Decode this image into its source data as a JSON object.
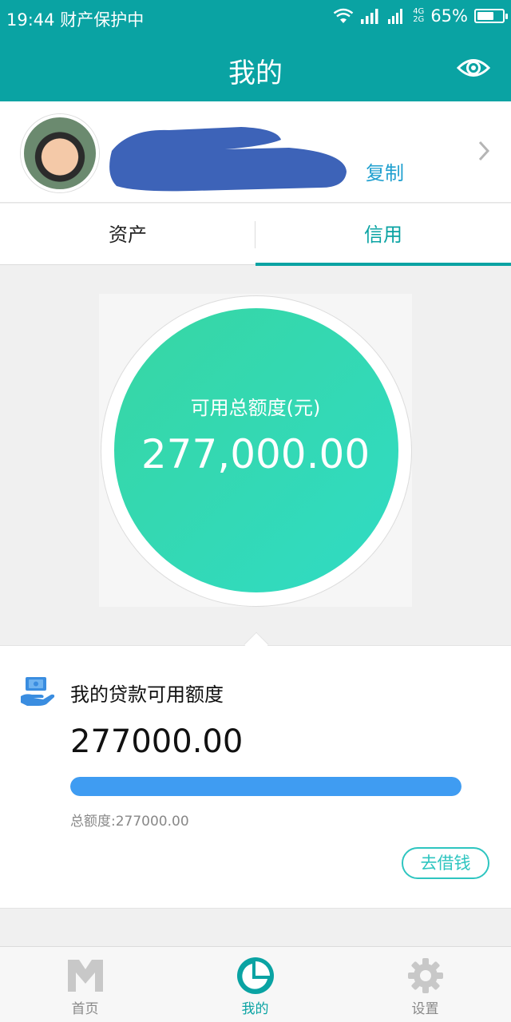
{
  "status_bar": {
    "time": "19:44",
    "notification": "财产保护中",
    "network": [
      "4G",
      "2G"
    ],
    "battery": "65%",
    "battery_level": 0.65
  },
  "header": {
    "title": "我的"
  },
  "profile": {
    "copy_label": "复制"
  },
  "tabs": [
    {
      "label": "资产"
    },
    {
      "label": "信用"
    }
  ],
  "credit": {
    "available_label": "可用总额度(元)",
    "available_value": "277,000.00"
  },
  "loan": {
    "title": "我的贷款可用额度",
    "amount": "277000.00",
    "progress": 1.0,
    "total_label": "总额度:277000.00",
    "borrow_button": "去借钱"
  },
  "bottom_nav": [
    {
      "label": "首页",
      "icon": "home-m-icon"
    },
    {
      "label": "我的",
      "icon": "pie-chart-icon"
    },
    {
      "label": "设置",
      "icon": "gear-icon"
    }
  ],
  "colors": {
    "brand": "#0aa3a3",
    "circle_start": "#37d6a3",
    "circle_end": "#30dbc4",
    "progress": "#3f9cf2",
    "link": "#1e9fcf"
  }
}
